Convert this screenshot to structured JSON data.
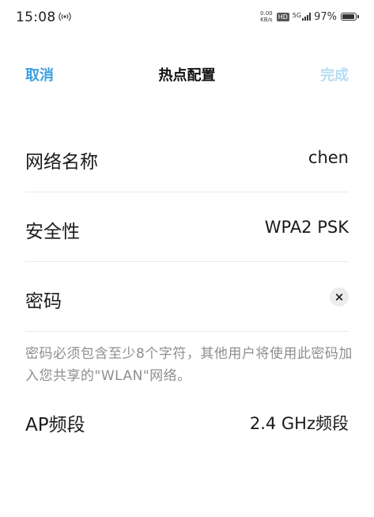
{
  "status_bar": {
    "time": "15:08",
    "hotspot_icon": "hotspot-broadcast-icon",
    "speed_value": "0.00",
    "speed_unit": "KB/s",
    "hd_label": "HD",
    "network_label": "5G",
    "battery_percent": "97%",
    "battery_level": 0.97
  },
  "nav": {
    "cancel_label": "取消",
    "title": "热点配置",
    "done_label": "完成"
  },
  "form": {
    "network_name": {
      "label": "网络名称",
      "value": "chen"
    },
    "security": {
      "label": "安全性",
      "value": "WPA2 PSK"
    },
    "password": {
      "label": "密码",
      "value": "",
      "clear_icon": "×"
    },
    "hint": "密码必须包含至少8个字符，其他用户将使用此密码加入您共享的\"WLAN\"网络。",
    "ap_band": {
      "label": "AP频段",
      "value": "2.4 GHz频段"
    }
  },
  "colors": {
    "accent": "#3aa0e0",
    "accent_disabled": "#b8dcf3",
    "hint_text": "#8e8e8e",
    "divider": "#e8e8e8"
  }
}
